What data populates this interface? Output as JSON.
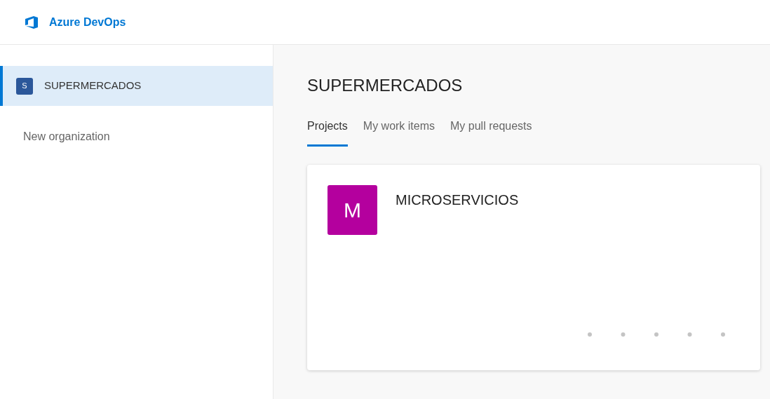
{
  "header": {
    "product": "Azure DevOps"
  },
  "sidebar": {
    "organizations": [
      {
        "initial": "S",
        "name": "SUPERMERCADOS",
        "selected": true,
        "color": "#2b579a"
      }
    ],
    "new_link": "New organization"
  },
  "main": {
    "title": "SUPERMERCADOS",
    "tabs": [
      {
        "label": "Projects",
        "selected": true
      },
      {
        "label": "My work items",
        "selected": false
      },
      {
        "label": "My pull requests",
        "selected": false
      }
    ],
    "projects": [
      {
        "initial": "M",
        "name": "MICROSERVICIOS",
        "color": "#b4009e"
      }
    ]
  }
}
